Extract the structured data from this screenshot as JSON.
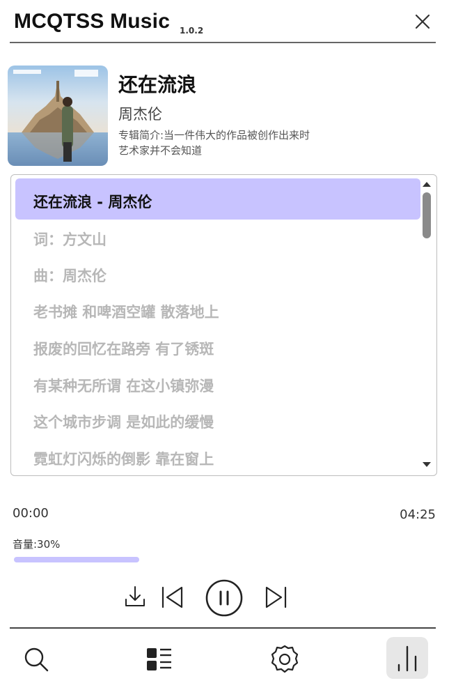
{
  "header": {
    "app_title": "MCQTSS Music",
    "version": "1.0.2",
    "close_icon": "close-icon"
  },
  "song": {
    "title": "还在流浪",
    "artist": "周杰伦",
    "album_description": "专辑简介:当一件伟大的作品被创作出来时 艺术家并不会知道"
  },
  "lyrics": {
    "active": "还在流浪 - 周杰伦",
    "lines": [
      "词：方文山",
      "曲：周杰伦",
      "老书摊 和啤酒空罐 散落地上",
      "报废的回忆在路旁 有了锈斑",
      "有某种无所谓 在这小镇弥漫",
      "这个城市步调 是如此的缓慢",
      "霓虹灯闪烁的倒影 靠在窗上"
    ]
  },
  "playback": {
    "current_time": "00:00",
    "total_time": "04:25",
    "volume_label": "音量:30%",
    "volume": 0.3
  },
  "controls": [
    "download-icon",
    "previous-icon",
    "pause-icon",
    "next-icon"
  ],
  "nav": [
    "search-icon",
    "playlist-icon",
    "settings-icon",
    "equalizer-icon"
  ],
  "colors": {
    "accent": "#c8c3ff",
    "lyric_inactive": "#b7b7b7"
  }
}
